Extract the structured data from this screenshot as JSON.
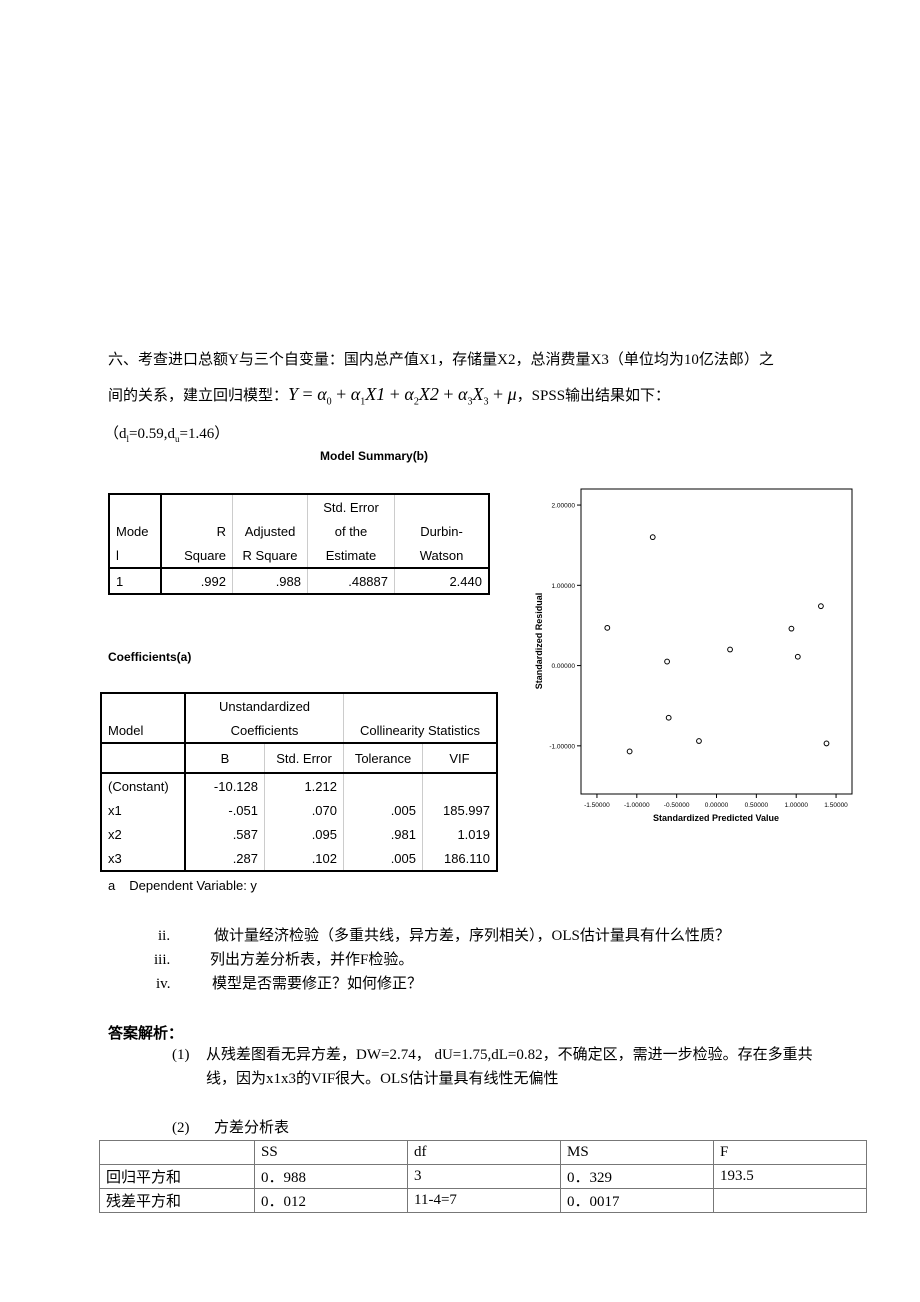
{
  "question": {
    "line1": "六、考查进口总额Y与三个自变量：国内总产值X1，存储量X2，总消费量X3（单位均为10亿法郎）之",
    "line2_prefix": "间的关系，建立回归模型：",
    "equation": {
      "y": "Y",
      "eq": " = ",
      "terms": [
        {
          "coef": "α",
          "sub": "0",
          "var": ""
        },
        {
          "coef": "α",
          "sub": "1",
          "var": "X1"
        },
        {
          "coef": "α",
          "sub": "2",
          "var": "X2"
        },
        {
          "coef": "α",
          "sub": "3",
          "var": "X",
          "var_sub": "3"
        }
      ],
      "error": "μ"
    },
    "line2_suffix": "，SPSS输出结果如下：",
    "dw_bounds": {
      "open": "（d",
      "l_sub": "l",
      "l_val": "=0.59,d",
      "u_sub": "u",
      "u_val": "=1.46）"
    }
  },
  "model_summary": {
    "title": "Model Summary(b)",
    "headers": {
      "model": [
        "Mode",
        "l"
      ],
      "r_square": [
        "",
        "R",
        "Square"
      ],
      "adj_r_square": [
        "",
        "Adjusted",
        "R Square"
      ],
      "std_error": [
        "Std. Error",
        "of the",
        "Estimate"
      ],
      "durbin_watson": [
        "",
        "Durbin-",
        "Watson"
      ]
    },
    "rows": [
      {
        "model": "1",
        "r_square": ".992",
        "adj_r_square": ".988",
        "std_error": ".48887",
        "durbin_watson": "2.440"
      }
    ]
  },
  "coefficients": {
    "title": "Coefficients(a)",
    "headers": {
      "model": "Model",
      "unstd": [
        "Unstandardized",
        "Coefficients"
      ],
      "collinearity": "Collinearity Statistics",
      "b": "B",
      "std_error": "Std. Error",
      "tolerance": "Tolerance",
      "vif": "VIF"
    },
    "rows": [
      {
        "name": "(Constant)",
        "b": "-10.128",
        "se": "1.212",
        "tol": "",
        "vif": ""
      },
      {
        "name": "x1",
        "b": "-.051",
        "se": ".070",
        "tol": ".005",
        "vif": "185.997"
      },
      {
        "name": "x2",
        "b": ".587",
        "se": ".095",
        "tol": ".981",
        "vif": "1.019"
      },
      {
        "name": "x3",
        "b": ".287",
        "se": ".102",
        "tol": ".005",
        "vif": "186.110"
      }
    ],
    "footnote_mark": "a",
    "footnote": "Dependent Variable: y"
  },
  "chart_data": {
    "type": "scatter",
    "title": "",
    "xlabel": "Standardized Predicted Value",
    "ylabel": "Standardized Residual",
    "xlim": [
      -1.7,
      1.7
    ],
    "ylim": [
      -1.6,
      2.2
    ],
    "x_ticks": [
      -1.5,
      -1.0,
      -0.5,
      0.0,
      0.5,
      1.0,
      1.5
    ],
    "x_tick_labels": [
      "-1.50000",
      "-1.00000",
      "-0.50000",
      "0.00000",
      "0.50000",
      "1.00000",
      "1.50000"
    ],
    "y_ticks": [
      2.0,
      1.0,
      0.0,
      -1.0
    ],
    "y_tick_labels": [
      "2.00000",
      "1.00000",
      "0.00000",
      "-1.00000"
    ],
    "grid": false,
    "marker": "open-circle",
    "points": [
      {
        "x": -1.37,
        "y": 0.47
      },
      {
        "x": -1.09,
        "y": -1.07
      },
      {
        "x": -0.8,
        "y": 1.6
      },
      {
        "x": -0.62,
        "y": 0.05
      },
      {
        "x": -0.6,
        "y": -0.65
      },
      {
        "x": -0.22,
        "y": -0.94
      },
      {
        "x": 0.17,
        "y": 0.2
      },
      {
        "x": 0.94,
        "y": 0.46
      },
      {
        "x": 1.02,
        "y": 0.11
      },
      {
        "x": 1.31,
        "y": 0.74
      },
      {
        "x": 1.38,
        "y": -0.97
      }
    ]
  },
  "sub_questions": [
    {
      "num": "ii.",
      "text": "做计量经济检验（多重共线，异方差，序列相关），OLS估计量具有什么性质？"
    },
    {
      "num": "iii.",
      "text": "列出方差分析表，并作F检验。"
    },
    {
      "num": "iv.",
      "text": "模型是否需要修正？如何修正？"
    }
  ],
  "answer": {
    "heading": "答案解析：",
    "part1_num": "(1)",
    "part1_line1": "从残差图看无异方差，DW=2.74， dU=1.75,dL=0.82，不确定区，需进一步检验。存在多重共",
    "part1_line2": "线，因为x1x3的VIF很大。OLS估计量具有线性无偏性",
    "part2_num": "(2)",
    "part2_title": "方差分析表"
  },
  "anova": {
    "headers": [
      "",
      "SS",
      "df",
      "MS",
      "F"
    ],
    "rows": [
      [
        "回归平方和",
        "0．988",
        "3",
        "0．329",
        "193.5"
      ],
      [
        "残差平方和",
        "0．012",
        "11-4=7",
        "0．0017",
        ""
      ]
    ]
  }
}
